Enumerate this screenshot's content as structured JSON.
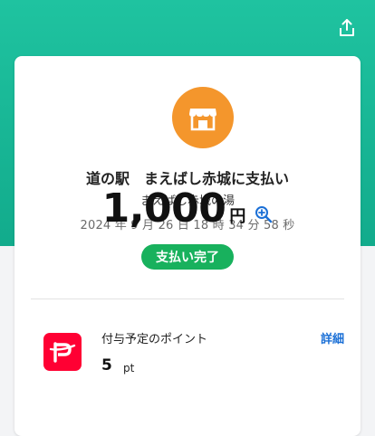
{
  "header": {
    "share_icon": "share-upload-icon"
  },
  "shop_icon": "storefront-icon",
  "merchant_name": "道の駅　まえばし赤城に支払い",
  "store_name": "まえばし赤城の湯",
  "datetime": "2024 年 9 月 26 日 18 時 34 分 58 秒",
  "amount": {
    "value": "1,000",
    "unit": "円",
    "zoom_icon": "magnifier-plus-icon"
  },
  "status": "支払い完了",
  "points": {
    "logo_icon": "paypay-logo-icon",
    "label": "付与予定のポイント",
    "value": "5",
    "unit": "pt",
    "details_link": "詳細"
  },
  "colors": {
    "header_green": "#1fc3a0",
    "shop_orange": "#f4962c",
    "status_green": "#18b15d",
    "link_blue": "#1a6fd6",
    "paypay_red": "#ff0033"
  }
}
